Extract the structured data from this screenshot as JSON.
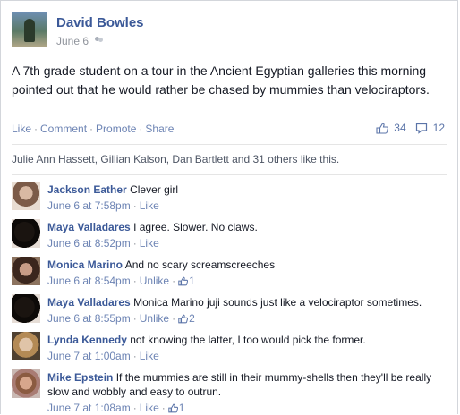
{
  "post": {
    "author": "David Bowles",
    "date": "June 6",
    "text": "A 7th grade student on a tour in the Ancient Egyptian galleries this morning pointed out that he would rather be chased by mummies than velociraptors."
  },
  "actions": {
    "like": "Like",
    "comment": "Comment",
    "promote": "Promote",
    "share": "Share",
    "separator": "·"
  },
  "counts": {
    "likes": "34",
    "comments": "12"
  },
  "likes_summary": "Julie Ann Hassett, Gillian Kalson, Dan Bartlett and 31 others like this.",
  "comments": [
    {
      "name": "Jackson Eather",
      "text": "Clever girl",
      "time": "June 6 at 7:58pm",
      "action": "Like",
      "likes": ""
    },
    {
      "name": "Maya Valladares",
      "text": "I agree. Slower. No claws.",
      "time": "June 6 at 8:52pm",
      "action": "Like",
      "likes": ""
    },
    {
      "name": "Monica Marino",
      "text": "And no scary screamscreeches",
      "time": "June 6 at 8:54pm",
      "action": "Unlike",
      "likes": "1"
    },
    {
      "name": "Maya Valladares",
      "text": "Monica Marino juji sounds just like a velociraptor sometimes.",
      "time": "June 6 at 8:55pm",
      "action": "Unlike",
      "likes": "2"
    },
    {
      "name": "Lynda Kennedy",
      "text": "not knowing the latter, I too would pick the former.",
      "time": "June 7 at 1:00am",
      "action": "Like",
      "likes": ""
    },
    {
      "name": "Mike Epstein",
      "text": "If the mummies are still in their mummy-shells then they'll be really slow and wobbly and easy to outrun.",
      "time": "June 7 at 1:08am",
      "action": "Like",
      "likes": "1"
    }
  ],
  "colors": {
    "link": "#3b5998",
    "meta": "#6d84b4",
    "muted": "#90949c",
    "text": "#141823"
  },
  "icons": {
    "audience": "friends-icon",
    "like_count": "thumbs-up-icon",
    "comment_count": "speech-bubble-icon"
  }
}
